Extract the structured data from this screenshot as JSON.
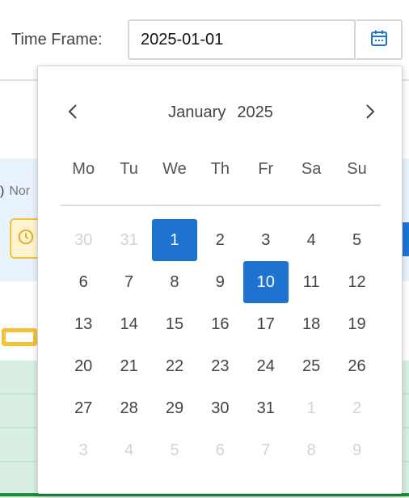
{
  "time_frame": {
    "label": "Time Frame:",
    "value": "2025-01-01",
    "calendar_icon": "calendar-icon"
  },
  "background": {
    "text_left": ")",
    "text_muted": "Nor",
    "clock_icon": "clock-icon"
  },
  "picker": {
    "month": "January",
    "year": "2025",
    "prev_icon": "chevron-left-icon",
    "next_icon": "chevron-right-icon",
    "weekdays": [
      "Mo",
      "Tu",
      "We",
      "Th",
      "Fr",
      "Sa",
      "Su"
    ],
    "selected_days": [
      "1",
      "10"
    ],
    "days": [
      {
        "label": "30",
        "muted": true
      },
      {
        "label": "31",
        "muted": true
      },
      {
        "label": "1",
        "muted": false
      },
      {
        "label": "2",
        "muted": false
      },
      {
        "label": "3",
        "muted": false
      },
      {
        "label": "4",
        "muted": false
      },
      {
        "label": "5",
        "muted": false
      },
      {
        "label": "6",
        "muted": false
      },
      {
        "label": "7",
        "muted": false
      },
      {
        "label": "8",
        "muted": false
      },
      {
        "label": "9",
        "muted": false
      },
      {
        "label": "10",
        "muted": false
      },
      {
        "label": "11",
        "muted": false
      },
      {
        "label": "12",
        "muted": false
      },
      {
        "label": "13",
        "muted": false
      },
      {
        "label": "14",
        "muted": false
      },
      {
        "label": "15",
        "muted": false
      },
      {
        "label": "16",
        "muted": false
      },
      {
        "label": "17",
        "muted": false
      },
      {
        "label": "18",
        "muted": false
      },
      {
        "label": "19",
        "muted": false
      },
      {
        "label": "20",
        "muted": false
      },
      {
        "label": "21",
        "muted": false
      },
      {
        "label": "22",
        "muted": false
      },
      {
        "label": "23",
        "muted": false
      },
      {
        "label": "24",
        "muted": false
      },
      {
        "label": "25",
        "muted": false
      },
      {
        "label": "26",
        "muted": false
      },
      {
        "label": "27",
        "muted": false
      },
      {
        "label": "28",
        "muted": false
      },
      {
        "label": "29",
        "muted": false
      },
      {
        "label": "30",
        "muted": false
      },
      {
        "label": "31",
        "muted": false
      },
      {
        "label": "1",
        "muted": true
      },
      {
        "label": "2",
        "muted": true
      },
      {
        "label": "3",
        "muted": true
      },
      {
        "label": "4",
        "muted": true
      },
      {
        "label": "5",
        "muted": true
      },
      {
        "label": "6",
        "muted": true
      },
      {
        "label": "7",
        "muted": true
      },
      {
        "label": "8",
        "muted": true
      },
      {
        "label": "9",
        "muted": true
      }
    ]
  },
  "colors": {
    "accent": "#1f73d0",
    "muted_text": "#d3d3d3",
    "band": "#e8f3fd",
    "green": "#d9efe2",
    "yellow": "#f3c23a"
  }
}
